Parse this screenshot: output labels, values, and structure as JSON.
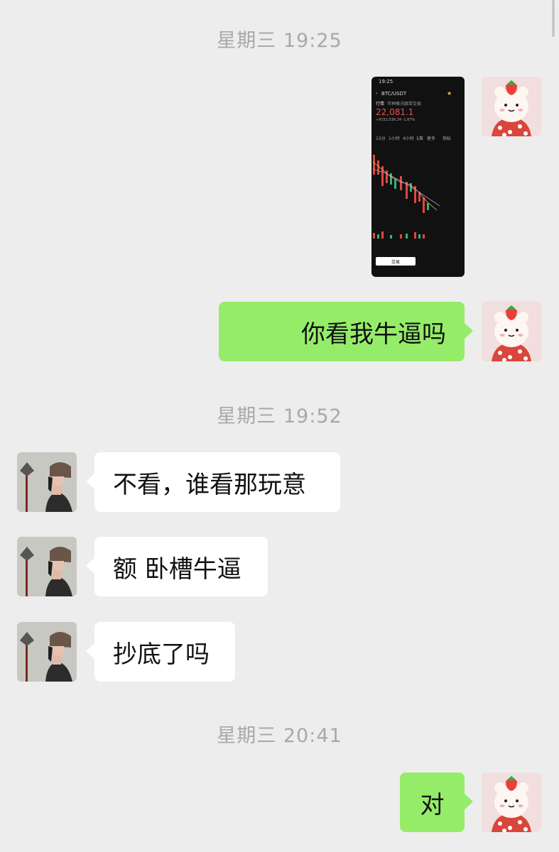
{
  "timestamps": [
    "星期三 19:25",
    "星期三 19:52",
    "星期三 20:41"
  ],
  "messages": {
    "m1": "你看我牛逼吗",
    "m2": "不看，谁看那玩意",
    "m3": "额 卧槽牛逼",
    "m4": "抄底了吗",
    "m5": "对"
  },
  "screenshot": {
    "time": "19:25",
    "pair": "BTC/USDT",
    "tabs": [
      "行情",
      "币种概况",
      "跟单交易"
    ],
    "price": "22,081.1",
    "change": "≈¥152,536.24  -1.87%",
    "intervals": [
      "15分",
      "1小时",
      "4小时",
      "1天",
      "更多",
      "指标"
    ],
    "trade_button": "交易"
  },
  "colors": {
    "bg": "#ededed",
    "green_bubble": "#95ec69",
    "white_bubble": "#ffffff",
    "timestamp": "#a8a8a8"
  }
}
